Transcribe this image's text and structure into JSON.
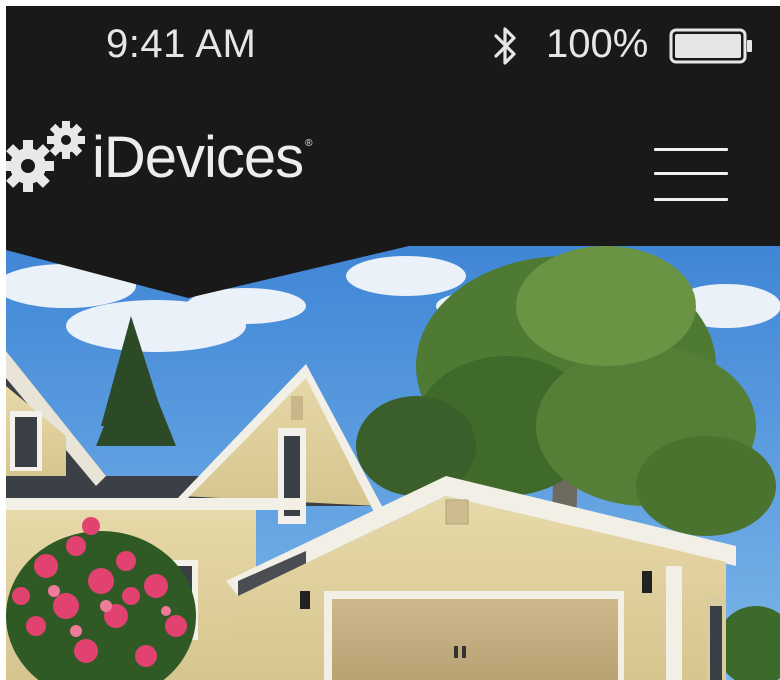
{
  "status_bar": {
    "time": "9:41 AM",
    "battery_percent": "100%",
    "battery_level": 1.0,
    "icons": [
      "bluetooth-icon",
      "battery-icon"
    ]
  },
  "header": {
    "brand": "iDevices",
    "logo_icon": "gears-icon",
    "menu_icon": "hamburger-menu-icon"
  },
  "hero": {
    "image": "house-with-garage-photo"
  },
  "colors": {
    "header_bg": "#1a1919",
    "text_light": "#ededed"
  }
}
